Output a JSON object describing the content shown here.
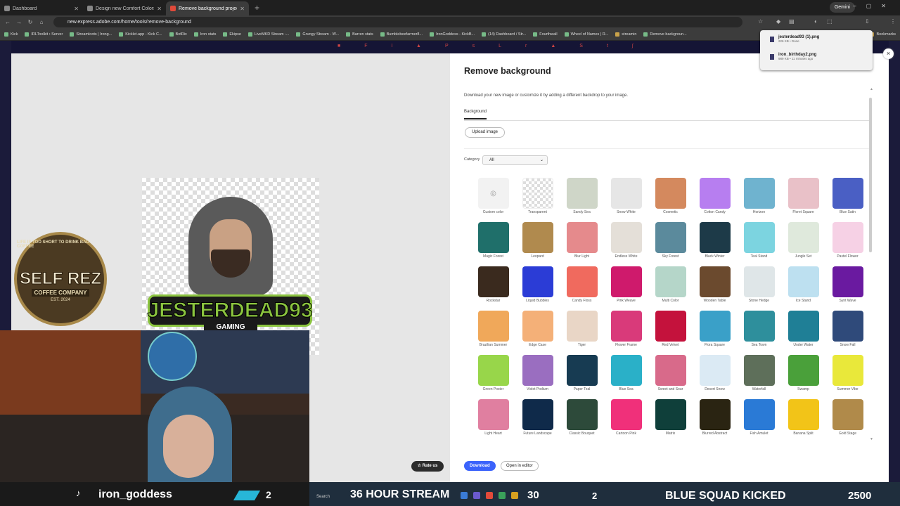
{
  "browser": {
    "tabs": [
      {
        "title": "Dashboard",
        "active": false
      },
      {
        "title": "Design new Comfort Colors Ga",
        "active": false
      },
      {
        "title": "Remove background project -",
        "active": true
      }
    ],
    "new_tab_glyph": "+",
    "gemini_label": "Gemini",
    "url": "new.express.adobe.com/home/tools/remove-background",
    "bookmarks": [
      "Kick",
      "IRLToolkit • Server",
      "Streamloots | Irong...",
      "Kicklet.app - Kick C...",
      "BotRix",
      "Iron stats",
      "Ekipse",
      "LiveMKD Stream -...",
      "Grungy Stream - W...",
      "Barren stats",
      "Bumblebeefarmer8...",
      "IronGoddess - KickB...",
      "(14) Dashboard / Str...",
      "Fourthwall",
      "Wheel of Names | R...",
      "streamin",
      "Remove backgroun..."
    ],
    "bookmarks_all": "Bookmarks"
  },
  "downloads": [
    {
      "name": "jesterdead93 (1).png",
      "status": "226 KB • Done"
    },
    {
      "name": "iron_birthday2.png",
      "status": "989 KB • 11 minutes ago"
    }
  ],
  "editor": {
    "close_glyph": "×",
    "rate_us": "Rate us"
  },
  "artwork": {
    "logo_text": "JESTERDEAD93",
    "logo_sub": "GAMING",
    "coffee_ring": "LIFE IS TOO SHORT TO DRINK BAD COFFEE",
    "coffee_title": "SELF REZ",
    "coffee_sub": "COFFEE COMPANY",
    "coffee_est": "EST. 2024"
  },
  "panel": {
    "title": "Remove background",
    "description": "Download your new image or customize it by adding a different backdrop to your image.",
    "tab": "Background",
    "upload_label": "Upload image",
    "category_label": "Category",
    "category_value": "All",
    "download_label": "Download",
    "open_in_editor_label": "Open in editor"
  },
  "backgrounds": [
    {
      "label": "Custom color",
      "color": "#f2f2f2",
      "kind": "custom"
    },
    {
      "label": "Transparent",
      "color": "#ffffff",
      "kind": "transparent"
    },
    {
      "label": "Sandy Sea",
      "color": "#cfd6c8"
    },
    {
      "label": "Snow White",
      "color": "#e6e6e6"
    },
    {
      "label": "Cosmetic",
      "color": "#d4895e"
    },
    {
      "label": "Cotton Candy",
      "color": "#b77ef0"
    },
    {
      "label": "Horizon",
      "color": "#6fb3cf"
    },
    {
      "label": "Floret Square",
      "color": "#e9c1c8"
    },
    {
      "label": "Blue Satin",
      "color": "#4a5fc4"
    },
    {
      "label": "Magic Forest",
      "color": "#1f6f6a"
    },
    {
      "label": "Leopard",
      "color": "#b08a4e"
    },
    {
      "label": "Blur Light",
      "color": "#e58a8c"
    },
    {
      "label": "Endless White",
      "color": "#e4dfd8"
    },
    {
      "label": "Sky Forest",
      "color": "#5b8a9c"
    },
    {
      "label": "Black Winter",
      "color": "#1d3a48"
    },
    {
      "label": "Teal Stand",
      "color": "#7cd4e0"
    },
    {
      "label": "Jungle Set",
      "color": "#dfe9dc"
    },
    {
      "label": "Pastel Flower",
      "color": "#f6d1e5"
    },
    {
      "label": "Rockstar",
      "color": "#3a2a1e"
    },
    {
      "label": "Liquid Bubbles",
      "color": "#2b3cd6"
    },
    {
      "label": "Candy Floss",
      "color": "#f06a5e"
    },
    {
      "label": "Pink Weave",
      "color": "#cf1a6c"
    },
    {
      "label": "Multi Color",
      "color": "#b5d6c9"
    },
    {
      "label": "Wooden Table",
      "color": "#6b4a2e"
    },
    {
      "label": "Stone Hedge",
      "color": "#dfe6e8"
    },
    {
      "label": "Ice Stand",
      "color": "#bde0f0"
    },
    {
      "label": "Synt Wave",
      "color": "#6a1aa0"
    },
    {
      "label": "Brazilian Summer",
      "color": "#f0a85a"
    },
    {
      "label": "Edge Case",
      "color": "#f4b078"
    },
    {
      "label": "Tiger",
      "color": "#e9d6c6"
    },
    {
      "label": "Flower Frame",
      "color": "#d93a7a"
    },
    {
      "label": "Red Velvet",
      "color": "#c4123c"
    },
    {
      "label": "Flora Square",
      "color": "#3aa0c8"
    },
    {
      "label": "Sea Town",
      "color": "#2e8f9c"
    },
    {
      "label": "Under Water",
      "color": "#1f7f96"
    },
    {
      "label": "Snow Fall",
      "color": "#2f4a7a"
    },
    {
      "label": "Green Poster",
      "color": "#98d64a"
    },
    {
      "label": "Violet Podium",
      "color": "#9a6ec0"
    },
    {
      "label": "Paper Teal",
      "color": "#173b52"
    },
    {
      "label": "Blue Sea",
      "color": "#2ab0c8"
    },
    {
      "label": "Sweet and Sour",
      "color": "#d86a8a"
    },
    {
      "label": "Desert Snow",
      "color": "#dbeaf4"
    },
    {
      "label": "Waterfall",
      "color": "#5e6f5a"
    },
    {
      "label": "Swamp",
      "color": "#4aa03a"
    },
    {
      "label": "Summer Vibe",
      "color": "#e9e83a"
    },
    {
      "label": "Light Heart",
      "color": "#e07fa0"
    },
    {
      "label": "Future Landscape",
      "color": "#0f2a4a"
    },
    {
      "label": "Classic Bouquet",
      "color": "#2d4a3a"
    },
    {
      "label": "Cartoon Pink",
      "color": "#f0307a"
    },
    {
      "label": "Matrix",
      "color": "#0f3f3a"
    },
    {
      "label": "Blurred Abstract",
      "color": "#2a2412"
    },
    {
      "label": "Fish Amulet",
      "color": "#2a7ad6"
    },
    {
      "label": "Banana Split",
      "color": "#f2c418"
    },
    {
      "label": "Gold Stage",
      "color": "#b08a4a"
    }
  ],
  "stream_overlay": {
    "username": "iron_goddess",
    "count_a": "2",
    "search_label": "Search",
    "headline": "36 HOUR STREAM",
    "count_b": "30",
    "count_c": "2",
    "kicked": "BLUE SQUAD KICKED",
    "count_d": "2500"
  }
}
